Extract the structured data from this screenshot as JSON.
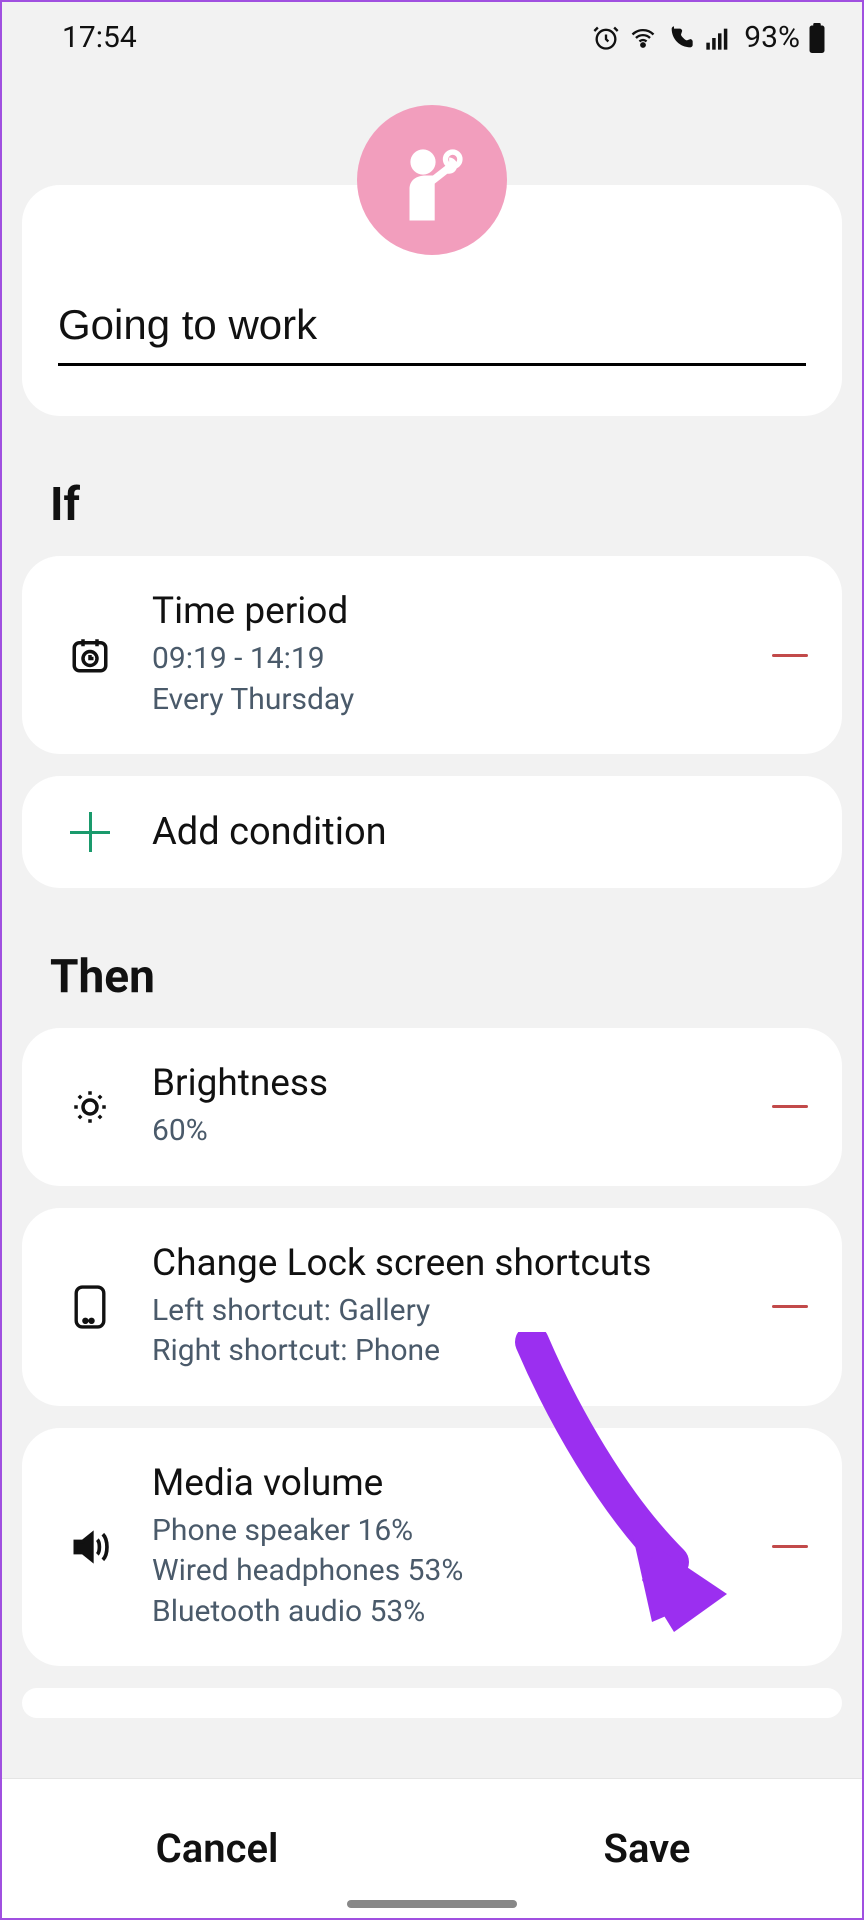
{
  "status": {
    "time": "17:54",
    "battery": "93%"
  },
  "routine": {
    "name": "Going to work"
  },
  "sections": {
    "if_label": "If",
    "then_label": "Then"
  },
  "if_items": [
    {
      "title": "Time period",
      "line1": "09:19 - 14:19",
      "line2": "Every Thursday"
    }
  ],
  "add_condition_label": "Add condition",
  "then_items": [
    {
      "title": "Brightness",
      "line1": "60%"
    },
    {
      "title": "Change Lock screen shortcuts",
      "line1": "Left shortcut: Gallery",
      "line2": "Right shortcut: Phone"
    },
    {
      "title": "Media volume",
      "line1": "Phone speaker 16%",
      "line2": "Wired headphones 53%",
      "line3": "Bluetooth audio 53%"
    }
  ],
  "buttons": {
    "cancel": "Cancel",
    "save": "Save"
  },
  "colors": {
    "accent_pink": "#f29ebd",
    "add_green": "#1a9a6c",
    "remove_red": "#c24a4a",
    "arrow_purple": "#9b2ff0"
  }
}
